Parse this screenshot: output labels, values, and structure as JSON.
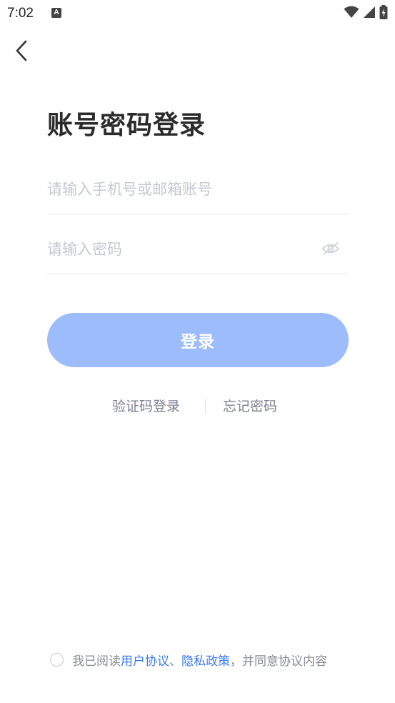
{
  "status_bar": {
    "time": "7:02",
    "notification_icon_letter": "A",
    "icons": [
      "wifi-icon",
      "signal-icon",
      "battery-charging-icon"
    ]
  },
  "header": {
    "back_icon": "chevron-left-icon"
  },
  "title": "账号密码登录",
  "form": {
    "account_placeholder": "请输入手机号或邮箱账号",
    "account_value": "",
    "password_placeholder": "请输入密码",
    "password_value": "",
    "password_visibility_icon": "eye-off-icon",
    "login_button_label": "登录"
  },
  "alt_links": {
    "sms_login": "验证码登录",
    "forgot_password": "忘记密码"
  },
  "agreement": {
    "prefix": "我已阅读",
    "user_agreement": "用户协议",
    "separator": "、",
    "privacy_policy": "隐私政策",
    "suffix": "，并同意协议内容",
    "checked": false
  },
  "colors": {
    "primary_button": "#9dbcfb",
    "link": "#3b7bf0",
    "placeholder": "#c4c8d0",
    "title": "#2b2b2b"
  }
}
